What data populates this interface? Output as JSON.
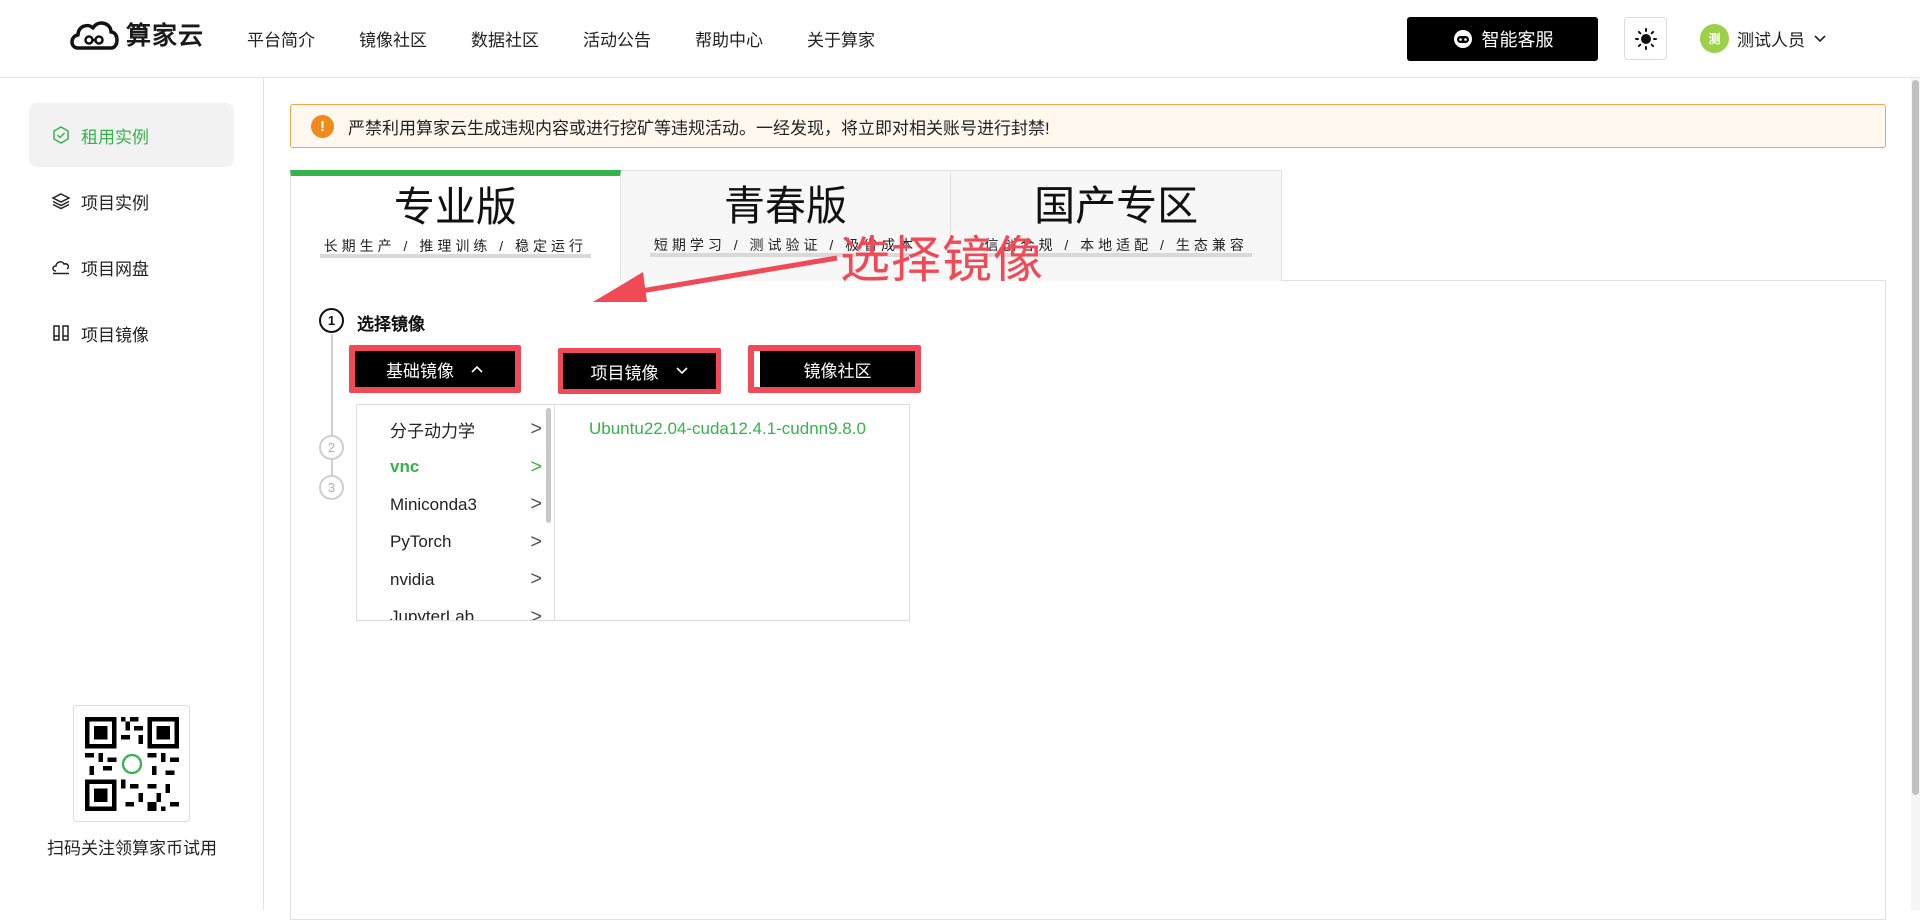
{
  "header": {
    "logo_text": "算家云",
    "nav": [
      "平台简介",
      "镜像社区",
      "数据社区",
      "活动公告",
      "帮助中心",
      "关于算家"
    ],
    "service_label": "智能客服",
    "user_name": "测试人员",
    "avatar_char": "测"
  },
  "sidebar": {
    "items": [
      {
        "label": "租用实例",
        "icon": "cube-icon"
      },
      {
        "label": "项目实例",
        "icon": "layers-icon"
      },
      {
        "label": "项目网盘",
        "icon": "cloud-drive-icon"
      },
      {
        "label": "项目镜像",
        "icon": "image-icon"
      }
    ],
    "qr_caption": "扫码关注领算家币试用"
  },
  "notice": {
    "icon": "!",
    "text": "严禁利用算家云生成违规内容或进行挖矿等违规活动。一经发现，将立即对相关账号进行封禁!"
  },
  "tabs": [
    {
      "title": "专业版",
      "subtitle": "长期生产 / 推理训练 / 稳定运行"
    },
    {
      "title": "青春版",
      "subtitle": "短期学习 / 测试验证 / 极省成本"
    },
    {
      "title": "国产专区",
      "subtitle": "信创合规 / 本地适配 / 生态兼容"
    }
  ],
  "steps": {
    "numbers": [
      "1",
      "2",
      "3"
    ],
    "step1_title": "选择镜像"
  },
  "image_buttons": {
    "base": "基础镜像",
    "project": "项目镜像",
    "community": "镜像社区"
  },
  "cascader": {
    "categories": [
      "分子动力学",
      "vnc",
      "Miniconda3",
      "PyTorch",
      "nvidia",
      "JupyterLab"
    ],
    "active_index": 1,
    "chevron": ">",
    "options": [
      "Ubuntu22.04-cuda12.4.1-cudnn9.8.0"
    ]
  },
  "annotation": {
    "text": "选择镜像"
  },
  "colors": {
    "brand_green": "#36b34a",
    "annotation_red": "#ef4a55",
    "warning_orange": "#f08a1c"
  }
}
